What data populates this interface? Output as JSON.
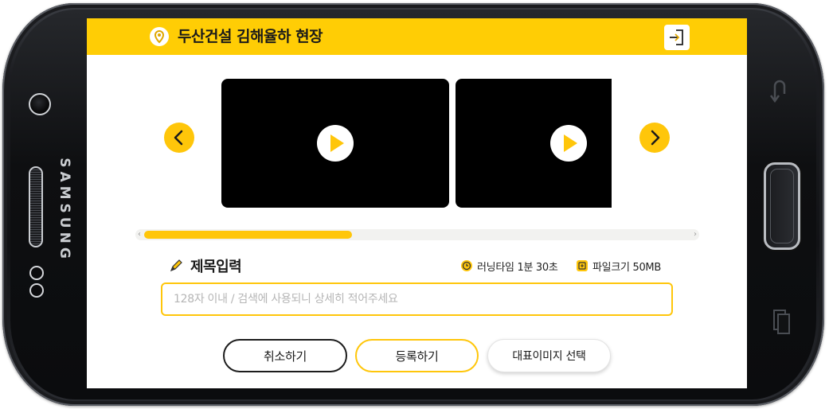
{
  "device": {
    "brand": "SAMSUNG"
  },
  "header": {
    "site_name": "두산건설 김해율하 현장",
    "accent_color": "#ffcd05",
    "location_icon": "location-pin-icon",
    "logout_icon": "logout-icon"
  },
  "carousel": {
    "prev_icon": "chevron-left-icon",
    "next_icon": "chevron-right-icon",
    "videos": [
      {
        "play_icon": "play-icon"
      },
      {
        "play_icon": "play-icon"
      }
    ],
    "scroll_progress": 0.38
  },
  "form": {
    "title_label": "제목입력",
    "title_icon": "pencil-icon",
    "running_time_label": "러닝타임 1분 30초",
    "running_time_icon": "clock-icon",
    "file_size_label": "파일크기 50MB",
    "file_size_icon": "file-size-icon",
    "title_input": {
      "value": "",
      "placeholder": "128자 이내 / 검색에 사용되니 상세히 적어주세요"
    }
  },
  "actions": {
    "cancel_label": "취소하기",
    "submit_label": "등록하기",
    "thumbnail_label": "대표이미지 선택"
  }
}
